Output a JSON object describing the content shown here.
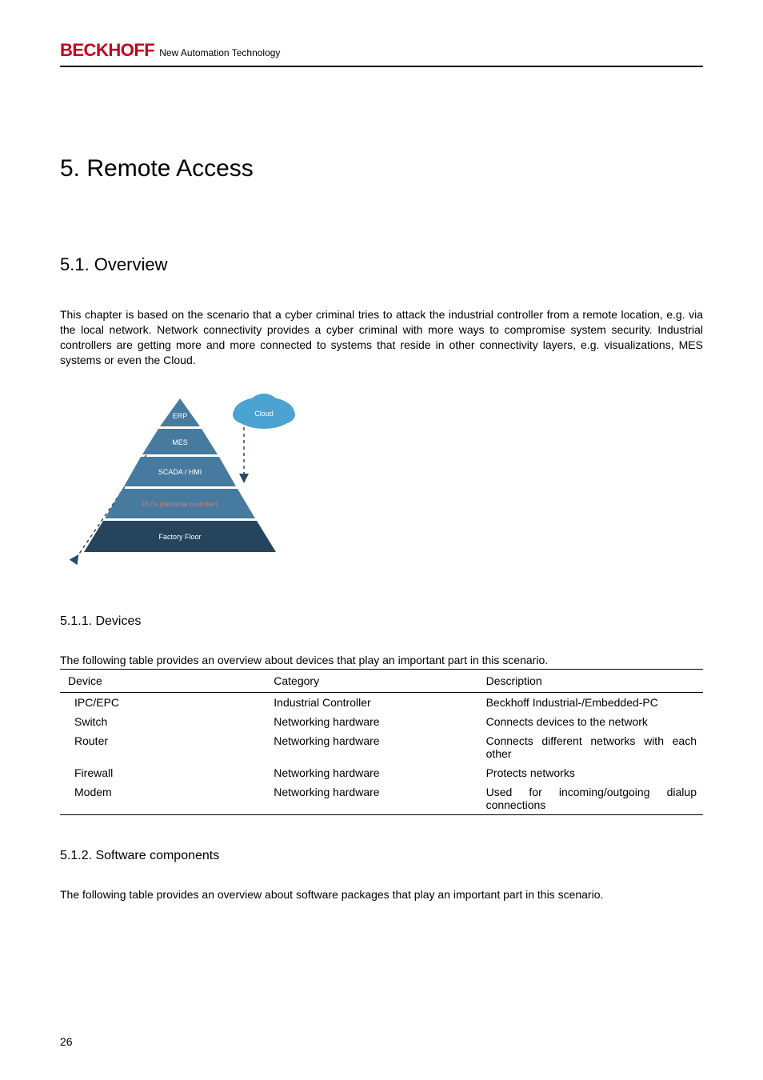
{
  "header": {
    "brand": "BECKHOFF",
    "tagline": "New Automation Technology"
  },
  "title": "5.  Remote Access",
  "section_overview": {
    "heading": "5.1.  Overview",
    "paragraph": "This chapter is based on the scenario that a cyber criminal tries to attack the industrial controller from a remote location, e.g. via the local network. Network connectivity provides a cyber criminal with more ways to compromise system security. Industrial controllers are getting more and more connected to systems that reside in other connectivity layers, e.g. visualizations, MES systems or even the Cloud."
  },
  "pyramid": {
    "layers": [
      "ERP",
      "MES",
      "SCADA / HMI",
      "PLCs (Industrial controller)",
      "Factory Floor"
    ],
    "cloud_label": "Cloud"
  },
  "section_devices": {
    "heading": "5.1.1.  Devices",
    "intro": "The following table provides an overview about devices that play an important part in this scenario.",
    "columns": [
      "Device",
      "Category",
      "Description"
    ],
    "rows": [
      {
        "device": "IPC/EPC",
        "category": "Industrial Controller",
        "description": "Beckhoff Industrial-/Embedded-PC"
      },
      {
        "device": "Switch",
        "category": "Networking hardware",
        "description": "Connects devices to the network"
      },
      {
        "device": "Router",
        "category": "Networking hardware",
        "description": "Connects different networks with each other"
      },
      {
        "device": "Firewall",
        "category": "Networking hardware",
        "description": "Protects networks"
      },
      {
        "device": "Modem",
        "category": "Networking hardware",
        "description": "Used for incoming/outgoing dialup connections"
      }
    ]
  },
  "section_software": {
    "heading": "5.1.2.  Software components",
    "paragraph": "The following table provides an overview about software packages that play an important part in this scenario."
  },
  "page_number": "26"
}
